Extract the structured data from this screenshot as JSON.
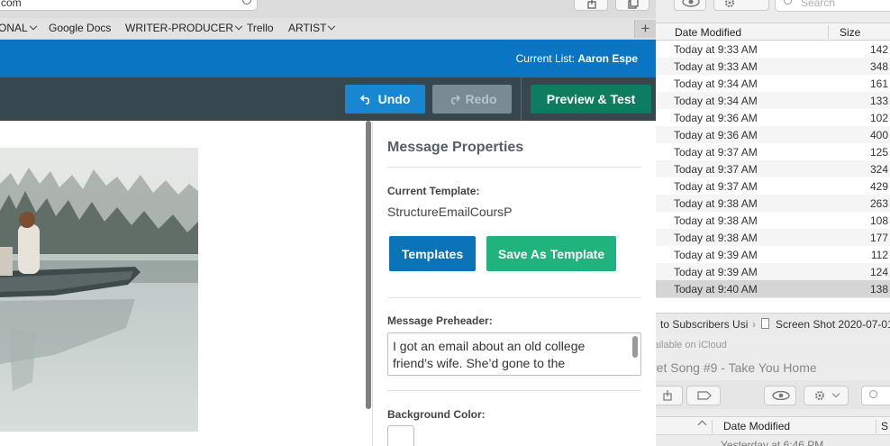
{
  "browser": {
    "url_fragment": "com",
    "bookmarks": [
      {
        "label": "ONAL",
        "has_menu": true
      },
      {
        "label": "Google Docs",
        "has_menu": false
      },
      {
        "label": "WRITER-PRODUCER",
        "has_menu": true
      },
      {
        "label": "Trello",
        "has_menu": false
      },
      {
        "label": "ARTIST",
        "has_menu": true
      }
    ],
    "new_tab_symbol": "+"
  },
  "app": {
    "current_list_label": "Current List:",
    "current_list_value": "Aaron Espe",
    "toolbar": {
      "undo_label": "Undo",
      "redo_label": "Redo",
      "preview_label": "Preview & Test"
    },
    "properties": {
      "title": "Message Properties",
      "current_template_label": "Current Template:",
      "current_template_value": "StructureEmailCoursP",
      "templates_button": "Templates",
      "save_as_template_button": "Save As Template",
      "preheader_label": "Message Preheader:",
      "preheader_value": "I got an email about an old college friend’s wife. She’d gone to the",
      "background_color_label": "Background Color:"
    },
    "colors": {
      "topbar": "#0a75c2",
      "toolbar": "#37474f",
      "undo": "#1787d2",
      "preview": "#0e7c5f",
      "templates": "#0b74b8",
      "save_template": "#20b37d"
    }
  },
  "finder": {
    "search_placeholder": "Search",
    "col_date": "Date Modified",
    "col_size": "Size",
    "rows": [
      {
        "date": "Today at 9:33 AM",
        "size": "142"
      },
      {
        "date": "Today at 9:33 AM",
        "size": "348"
      },
      {
        "date": "Today at 9:34 AM",
        "size": "161"
      },
      {
        "date": "Today at 9:34 AM",
        "size": "133"
      },
      {
        "date": "Today at 9:36 AM",
        "size": "102"
      },
      {
        "date": "Today at 9:36 AM",
        "size": "400"
      },
      {
        "date": "Today at 9:37 AM",
        "size": "125"
      },
      {
        "date": "Today at 9:37 AM",
        "size": "324"
      },
      {
        "date": "Today at 9:37 AM",
        "size": "429"
      },
      {
        "date": "Today at 9:38 AM",
        "size": "263"
      },
      {
        "date": "Today at 9:38 AM",
        "size": "108"
      },
      {
        "date": "Today at 9:38 AM",
        "size": "177"
      },
      {
        "date": "Today at 9:39 AM",
        "size": "112"
      },
      {
        "date": "Today at 9:39 AM",
        "size": "124"
      },
      {
        "date": "Today at 9:40 AM",
        "size": "138",
        "selected": true
      }
    ],
    "path_part1": "to Subscribers Usi",
    "path_part2": "Screen Shot 2020-07-01",
    "icloud_text": "vailable on iCloud",
    "song_title": "ret Song #9 - Take You Home",
    "second_col_date": "Date Modified",
    "second_col_size": "S",
    "second_row_partial": "Yesterday at 6:46 PM"
  }
}
